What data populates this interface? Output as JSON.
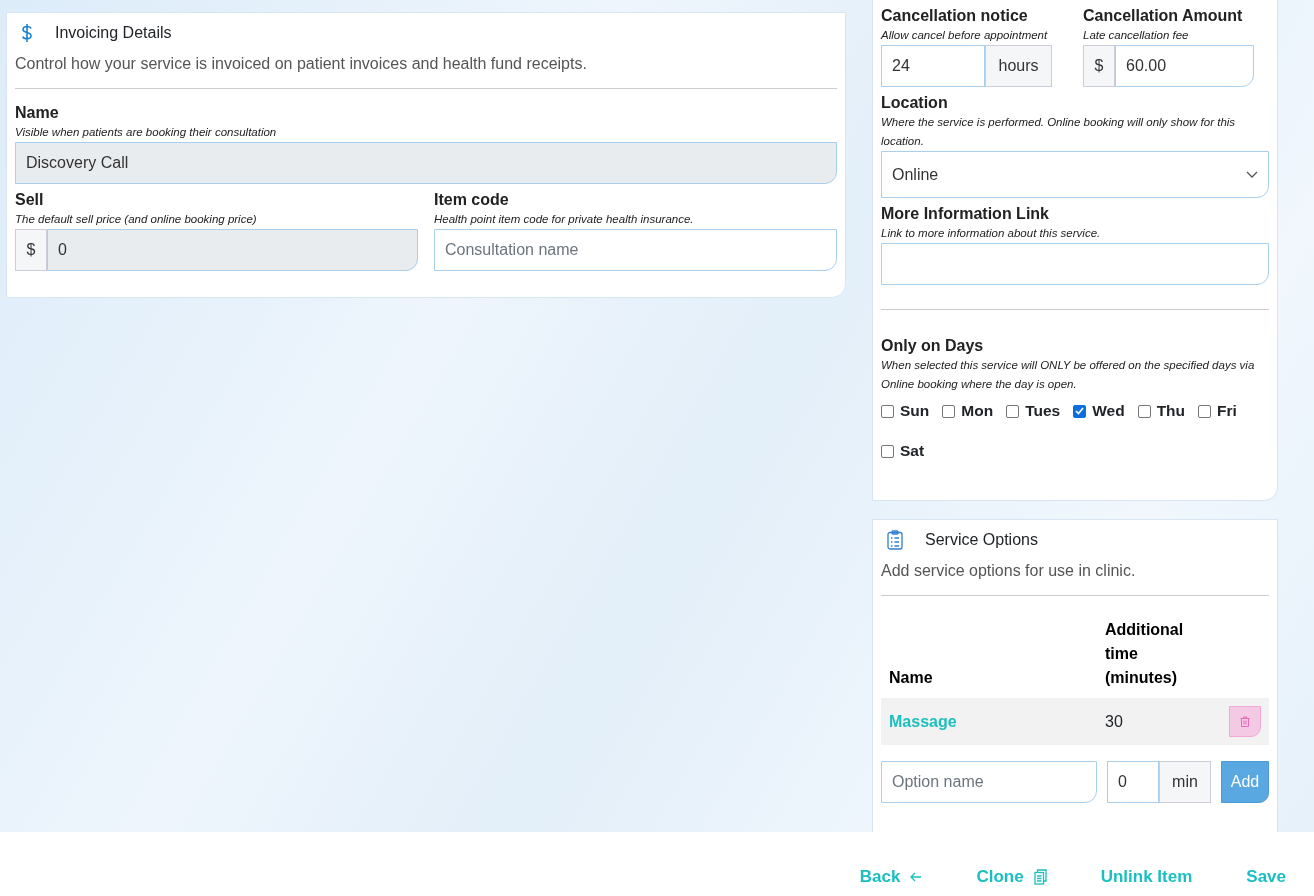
{
  "invoicing": {
    "title": "Invoicing Details",
    "description": "Control how your service is invoiced on patient invoices and health fund receipts.",
    "name": {
      "label": "Name",
      "hint": "Visible when patients are booking their consultation",
      "value": "Discovery Call",
      "disabled": true
    },
    "sell": {
      "label": "Sell",
      "hint": "The default sell price (and online booking price)",
      "prefix": "$",
      "value": "0",
      "disabled": true
    },
    "item_code": {
      "label": "Item code",
      "hint": "Health point item code for private health insurance.",
      "placeholder": "Consultation name"
    }
  },
  "booking": {
    "cancellation_notice": {
      "label": "Cancellation notice",
      "hint": "Allow cancel before appointment",
      "value": "24",
      "suffix": "hours"
    },
    "cancellation_amount": {
      "label": "Cancellation Amount",
      "hint": "Late cancellation fee",
      "prefix": "$",
      "value": "60.00"
    },
    "location": {
      "label": "Location",
      "hint": "Where the service is performed. Online booking will only show for this location.",
      "value": "Online"
    },
    "more_info": {
      "label": "More Information Link",
      "hint": "Link to more information about this service."
    },
    "days": {
      "label": "Only on Days",
      "hint": "When selected this service will ONLY be offered on the specified days via Online booking where the day is open.",
      "items": [
        {
          "label": "Sun",
          "checked": false
        },
        {
          "label": "Mon",
          "checked": false
        },
        {
          "label": "Tues",
          "checked": false
        },
        {
          "label": "Wed",
          "checked": true
        },
        {
          "label": "Thu",
          "checked": false
        },
        {
          "label": "Fri",
          "checked": false
        },
        {
          "label": "Sat",
          "checked": false
        }
      ]
    }
  },
  "service_options": {
    "title": "Service Options",
    "description": "Add service options for use in clinic.",
    "columns": [
      "Name",
      "Additional time (minutes)"
    ],
    "rows": [
      {
        "name": "Massage",
        "time": "30"
      }
    ],
    "new_option": {
      "placeholder": "Option name",
      "minutes": "0",
      "suffix": "min",
      "button": "Add"
    }
  },
  "footer": {
    "actions": [
      {
        "label": "Back",
        "kind": "back"
      },
      {
        "label": "Clone",
        "kind": "clone"
      },
      {
        "label": "Unlink Item",
        "kind": "plain"
      },
      {
        "label": "Save",
        "kind": "plain"
      }
    ]
  }
}
